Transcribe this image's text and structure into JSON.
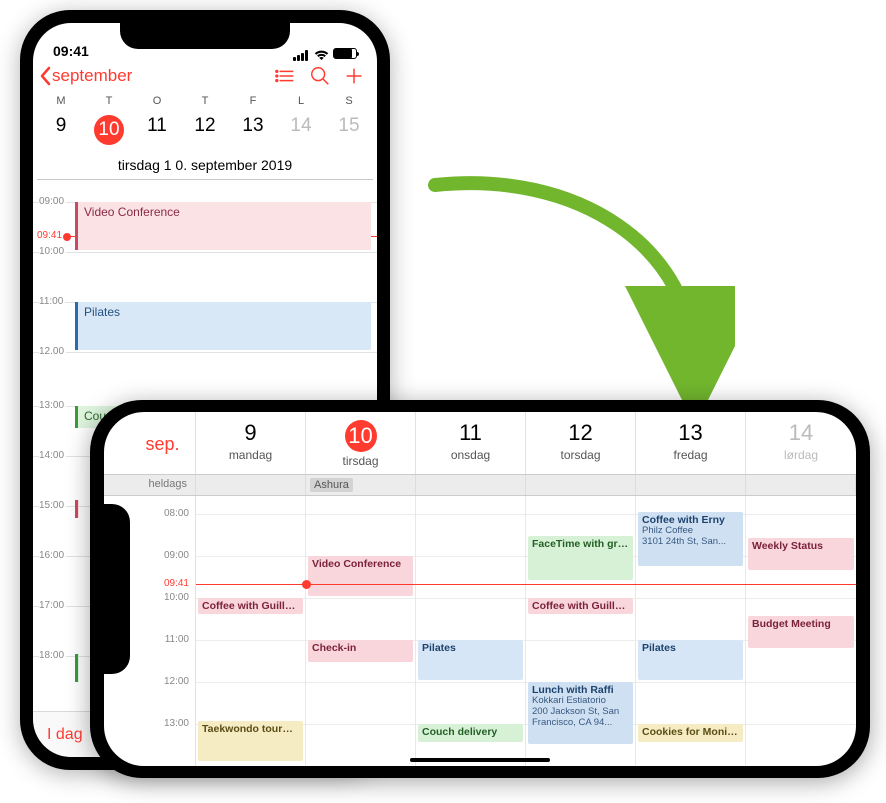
{
  "status": {
    "time": "09:41"
  },
  "portrait": {
    "back_label": "september",
    "dow": [
      "M",
      "T",
      "O",
      "T",
      "F",
      "L",
      "S"
    ],
    "days": [
      "9",
      "10",
      "11",
      "12",
      "13",
      "14",
      "15"
    ],
    "today_index": 1,
    "date_full": "tirsdag 1 0. september 2019",
    "now_label": "09:41",
    "hours": [
      "09:00",
      "10:00",
      "11:00",
      "12.00",
      "13:00",
      "14:00",
      "15:00",
      "16:00",
      "17:00",
      "18:00"
    ],
    "events": {
      "video": "Video Conference",
      "pilates": "Pilates",
      "couch": "Couch deli..."
    },
    "today_button": "I dag"
  },
  "landscape": {
    "month_short": "sep.",
    "cols": [
      {
        "num": "9",
        "dow": "mandag"
      },
      {
        "num": "10",
        "dow": "tirsdag"
      },
      {
        "num": "11",
        "dow": "onsdag"
      },
      {
        "num": "12",
        "dow": "torsdag"
      },
      {
        "num": "13",
        "dow": "fredag"
      },
      {
        "num": "14",
        "dow": "lørdag"
      }
    ],
    "today_index": 1,
    "allday_label": "heldags",
    "allday": {
      "ashura": "Ashura"
    },
    "times": [
      "08:00",
      "09:00",
      "10:00",
      "11:00",
      "12:00",
      "13:00"
    ],
    "now_label": "09:41",
    "events": {
      "taekwondo": "Taekwondo tournament",
      "coffee_guille1": "Coffee with Guille...",
      "checkin": "Check-in",
      "video": "Video Conference",
      "pilates1": "Pilates",
      "couch": "Couch delivery",
      "facetime": "FaceTime with grandma",
      "coffee_guille2": "Coffee with Guille...",
      "lunch_title": "Lunch with Raffi",
      "lunch_sub1": "Kokkari Estiatorio",
      "lunch_sub2": "200 Jackson St, San Francisco, CA  94...",
      "coffee_erny_title": "Coffee with Erny",
      "coffee_erny_sub1": "Philz Coffee",
      "coffee_erny_sub2": "3101 24th St, San...",
      "pilates2": "Pilates",
      "cookies": "Cookies for Monic...",
      "weekly": "Weekly Status",
      "budget": "Budget Meeting"
    }
  }
}
